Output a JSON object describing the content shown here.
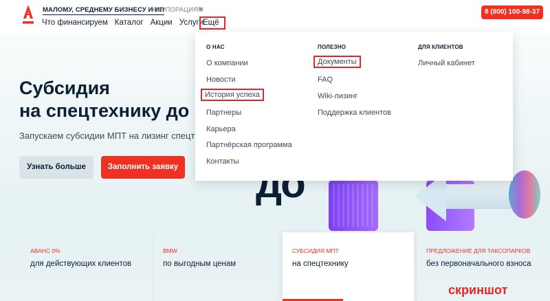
{
  "header": {
    "segment_active": "МАЛОМУ, СРЕДНЕМУ БИЗНЕСУ И ИП",
    "segment_corp": "КОРПОРАЦИЯМ",
    "nav": [
      "Что финансируем",
      "Каталог",
      "Акции",
      "Услуги"
    ],
    "more": "Ещё",
    "phone": "8 (800) 100-98-37"
  },
  "dropdown": {
    "col1": {
      "heading": "О НАС",
      "items": [
        "О компании",
        "Новости",
        "История успеха",
        "Партнеры",
        "Карьера",
        "Партнёрская программа",
        "Контакты"
      ]
    },
    "col2": {
      "heading": "ПОЛЕЗНО",
      "items": [
        "Документы",
        "FAQ",
        "Wiki-лизинг",
        "Поддержка клиентов"
      ]
    },
    "col3": {
      "heading": "ДЛЯ КЛИЕНТОВ",
      "items": [
        "Личный кабинет"
      ]
    }
  },
  "hero": {
    "title_line1": "Субсидия",
    "title_line2": "на спецтехнику до",
    "subtitle": "Запускаем субсидии МПТ на лизинг спецтехни",
    "btn_more": "Узнать больше",
    "btn_apply": "Заполнить заявку",
    "art_text": "до"
  },
  "cards": [
    {
      "title": "АВАНС 0%",
      "desc": "для действующих клиентов"
    },
    {
      "title": "BMW",
      "desc": "по выгодным ценам"
    },
    {
      "title": "СУБСИДИЯ МПТ",
      "desc": "на спецтехнику"
    },
    {
      "title": "ПРЕДЛОЖЕНИЕ ДЛЯ ТАКСОПАРКОВ",
      "desc": "без первоначального взноса"
    }
  ],
  "watermark": "скриншот",
  "colors": {
    "brand_red": "#ef3124",
    "highlight": "#e32626",
    "text": "#0b1f35"
  }
}
